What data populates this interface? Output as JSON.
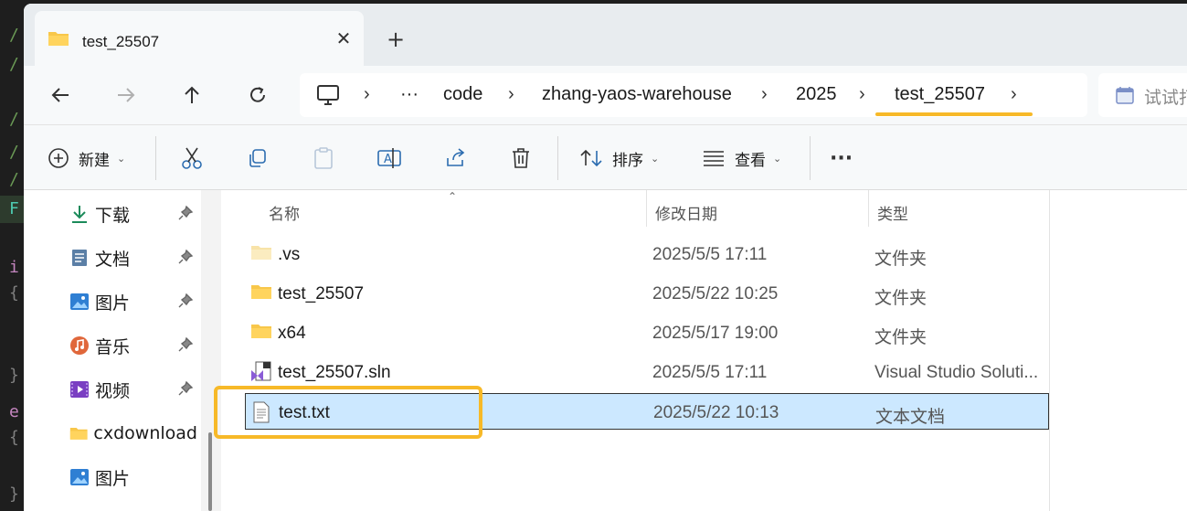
{
  "editor": {
    "glyphs": [
      "/",
      "/",
      "/",
      "/",
      "/",
      "F",
      "i",
      "{",
      "}",
      "e",
      "{",
      "}"
    ]
  },
  "tab": {
    "title": "test_25507",
    "close_icon": "close-icon",
    "new_tab_icon": "plus-icon"
  },
  "nav_buttons": [
    "back-arrow-icon",
    "forward-arrow-icon",
    "up-arrow-icon",
    "refresh-icon"
  ],
  "address": {
    "computer_icon": "computer-icon",
    "ellipsis": "···",
    "crumbs": [
      "code",
      "zhang-yaos-warehouse",
      "2025",
      "test_25507"
    ],
    "separator": "›"
  },
  "search": {
    "placeholder": "试试打"
  },
  "commands": {
    "new_label": "新建",
    "sort_label": "排序",
    "view_label": "查看",
    "more": "···"
  },
  "sidebar": {
    "items": [
      {
        "label": "下载",
        "icon": "download-icon",
        "pinned": true
      },
      {
        "label": "文档",
        "icon": "documents-icon",
        "pinned": true
      },
      {
        "label": "图片",
        "icon": "pictures-icon",
        "pinned": true
      },
      {
        "label": "音乐",
        "icon": "music-icon",
        "pinned": true
      },
      {
        "label": "视频",
        "icon": "videos-icon",
        "pinned": true
      },
      {
        "label": "cxdownload",
        "icon": "folder-icon",
        "pinned": false
      },
      {
        "label": "图片",
        "icon": "pictures-icon",
        "pinned": false
      }
    ]
  },
  "columns": {
    "name": "名称",
    "date": "修改日期",
    "type": "类型"
  },
  "files": [
    {
      "name": ".vs",
      "date": "2025/5/5 17:11",
      "type": "文件夹",
      "icon": "folder-icon"
    },
    {
      "name": "test_25507",
      "date": "2025/5/22 10:25",
      "type": "文件夹",
      "icon": "folder-icon"
    },
    {
      "name": "x64",
      "date": "2025/5/17 19:00",
      "type": "文件夹",
      "icon": "folder-icon"
    },
    {
      "name": "test_25507.sln",
      "date": "2025/5/5 17:11",
      "type": "Visual Studio Soluti...",
      "icon": "sln-file-icon"
    },
    {
      "name": "test.txt",
      "date": "2025/5/22 10:13",
      "type": "文本文档",
      "icon": "text-file-icon",
      "selected": true
    }
  ],
  "colors": {
    "highlight": "#f7b928",
    "selection": "#cce8ff",
    "folder": "#f8c74a"
  }
}
